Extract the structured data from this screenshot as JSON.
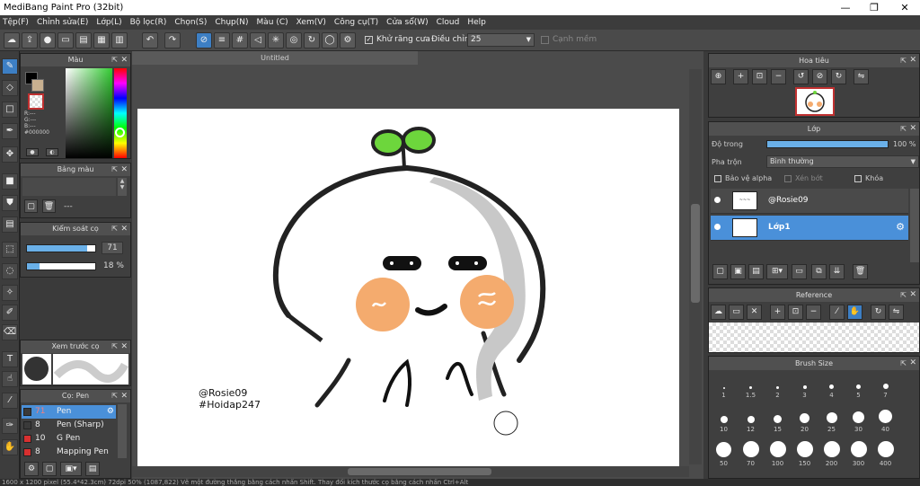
{
  "window": {
    "title": "MediBang Paint Pro (32bit)",
    "minimize": "—",
    "maximize": "❐",
    "close": "✕"
  },
  "menu": [
    "Tệp(F)",
    "Chỉnh sửa(E)",
    "Lớp(L)",
    "Bộ lọc(R)",
    "Chọn(S)",
    "Chụp(N)",
    "Màu (C)",
    "Xem(V)",
    "Công cụ(T)",
    "Cửa sổ(W)",
    "Cloud",
    "Help"
  ],
  "toolbar": {
    "antialias_label": "Khử răng cưa",
    "adjust_label": "Điều chỉnh",
    "adjust_value": "25",
    "edge_label": "Cạnh mềm"
  },
  "color_panel": {
    "title": "Màu",
    "r": "R:---",
    "g": "G:---",
    "b": "B:---",
    "hex": "#000000"
  },
  "palette_panel": {
    "title": "Bảng màu",
    "dash": "---"
  },
  "brush_control": {
    "title": "Kiểm soát cọ",
    "size": "71",
    "opacity": "18 %",
    "size_fraction": 0.88,
    "opacity_fraction": 0.18
  },
  "brush_preview": {
    "title": "Xem trước cọ"
  },
  "brush_list": {
    "title": "Cọ: Pen",
    "items": [
      {
        "size": "71",
        "name": "Pen",
        "color": "#3a3a3a",
        "selected": true
      },
      {
        "size": "8",
        "name": "Pen (Sharp)",
        "color": "#3a3a3a",
        "selected": false
      },
      {
        "size": "10",
        "name": "G Pen",
        "color": "#d83030",
        "selected": false
      },
      {
        "size": "8",
        "name": "Mapping Pen",
        "color": "#d83030",
        "selected": false
      }
    ]
  },
  "canvas": {
    "tab_title": "Untitled",
    "text_line1": "@Rosie09",
    "text_line2": "#Hoidap247"
  },
  "navigator": {
    "title": "Hoa tiêu"
  },
  "layer_panel": {
    "title": "Lớp",
    "opacity_label": "Độ trong",
    "opacity_value": "100 %",
    "blend_label": "Pha trộn",
    "blend_value": "Bình thường",
    "protect_alpha": "Bảo vệ alpha",
    "clipping": "Xén bớt",
    "lock": "Khóa",
    "layers": [
      {
        "name": "@Rosie09",
        "selected": false
      },
      {
        "name": "Lớp1",
        "selected": true
      }
    ]
  },
  "reference": {
    "title": "Reference"
  },
  "brush_size": {
    "title": "Brush Size",
    "sizes": [
      "1",
      "1.5",
      "2",
      "3",
      "4",
      "5",
      "7",
      "10",
      "12",
      "15",
      "20",
      "25",
      "30",
      "40",
      "50",
      "70",
      "100",
      "150",
      "200",
      "300",
      "400"
    ]
  },
  "status": {
    "text": "1600 x 1200 pixel  (55.4*42.3cm)  72dpi  50%  (1087,822)  Vẽ một đường thẳng bằng cách nhấn Shift. Thay đổi kích thước cọ bằng cách nhấn Ctrl+Alt"
  },
  "colors": {
    "accent": "#3d7fc4",
    "selected_layer": "#4a90d9",
    "panel": "#3f3f3f"
  }
}
